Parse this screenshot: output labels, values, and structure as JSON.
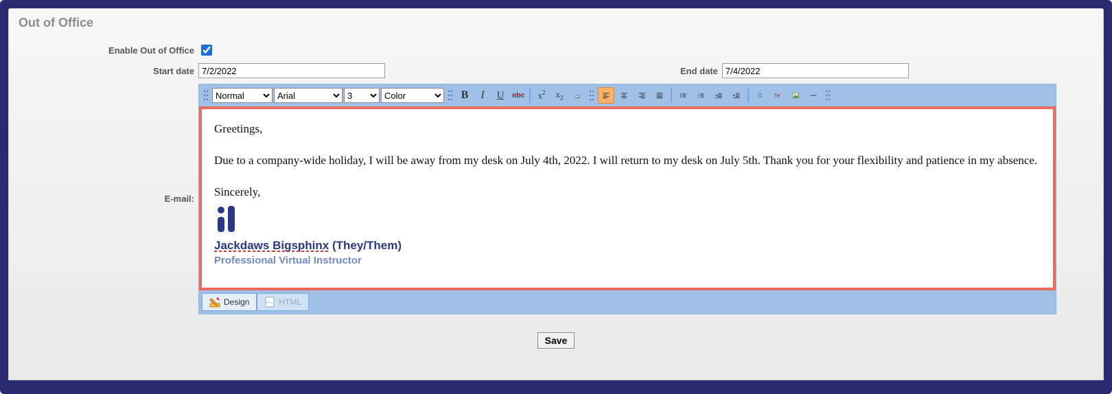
{
  "panel": {
    "title": "Out of Office"
  },
  "labels": {
    "enable": "Enable Out of Office",
    "start": "Start date",
    "end": "End date",
    "email": "E-mail:"
  },
  "form": {
    "enable_checked": true,
    "start_date": "7/2/2022",
    "end_date": "7/4/2022"
  },
  "toolbar": {
    "format_sel": "Normal",
    "font_sel": "Arial",
    "size_sel": "3",
    "color_sel": "Color"
  },
  "body": {
    "greeting": "Greetings,",
    "para": "Due to a company-wide holiday, I will be away from my desk on July 4th, 2022. I will return to my desk on July 5th. Thank you for your flexibility and patience in my absence.",
    "signoff": "Sincerely,"
  },
  "signature": {
    "name1": "Jackdaws ",
    "name2": "Bigsphinx",
    "pronouns": " (They/Them)",
    "title": "Professional Virtual Instructor"
  },
  "tabs": {
    "design": "Design",
    "html": "HTML"
  },
  "save": "Save"
}
